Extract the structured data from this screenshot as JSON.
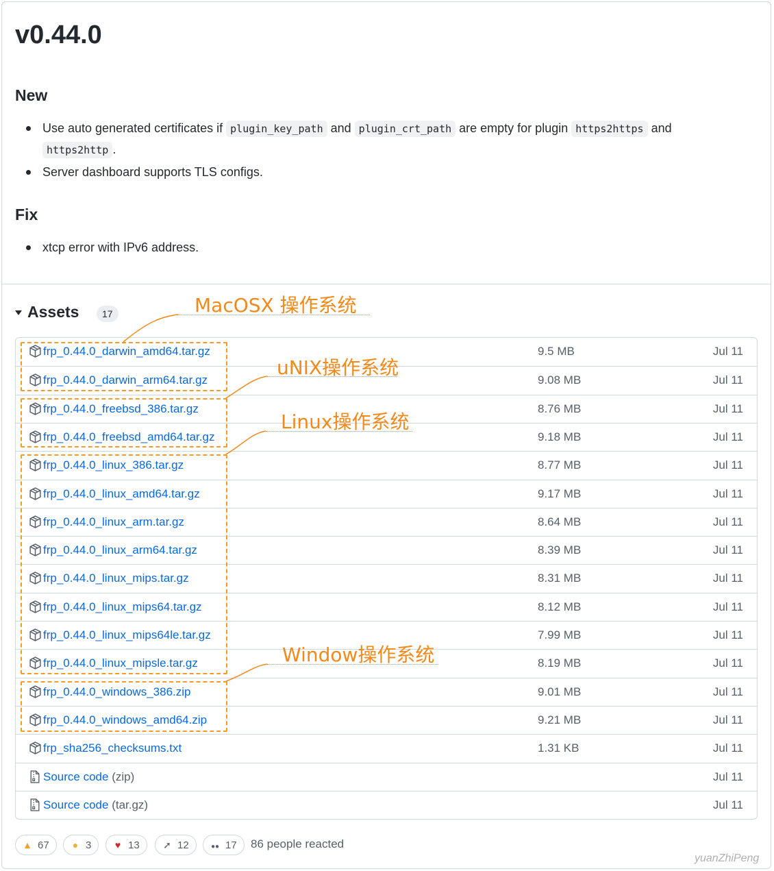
{
  "release": {
    "title": "v0.44.0",
    "new_heading": "New",
    "new_items": [
      {
        "parts": [
          "Use auto generated certificates if ",
          "plugin_key_path",
          " and ",
          "plugin_crt_path",
          " are empty for plugin ",
          "https2https",
          " and "
        ],
        "cont": [
          "https2http",
          "."
        ]
      },
      {
        "text": "Server dashboard supports TLS configs."
      }
    ],
    "fix_heading": "Fix",
    "fix_items": [
      "xtcp error with IPv6 address."
    ]
  },
  "assets": {
    "label": "Assets",
    "count": "17",
    "rows": [
      {
        "icon": "package-icon",
        "name": "frp_0.44.0_darwin_amd64.tar.gz",
        "size": "9.5 MB",
        "date": "Jul 11"
      },
      {
        "icon": "package-icon",
        "name": "frp_0.44.0_darwin_arm64.tar.gz",
        "size": "9.08 MB",
        "date": "Jul 11"
      },
      {
        "icon": "package-icon",
        "name": "frp_0.44.0_freebsd_386.tar.gz",
        "size": "8.76 MB",
        "date": "Jul 11"
      },
      {
        "icon": "package-icon",
        "name": "frp_0.44.0_freebsd_amd64.tar.gz",
        "size": "9.18 MB",
        "date": "Jul 11"
      },
      {
        "icon": "package-icon",
        "name": "frp_0.44.0_linux_386.tar.gz",
        "size": "8.77 MB",
        "date": "Jul 11"
      },
      {
        "icon": "package-icon",
        "name": "frp_0.44.0_linux_amd64.tar.gz",
        "size": "9.17 MB",
        "date": "Jul 11"
      },
      {
        "icon": "package-icon",
        "name": "frp_0.44.0_linux_arm.tar.gz",
        "size": "8.64 MB",
        "date": "Jul 11"
      },
      {
        "icon": "package-icon",
        "name": "frp_0.44.0_linux_arm64.tar.gz",
        "size": "8.39 MB",
        "date": "Jul 11"
      },
      {
        "icon": "package-icon",
        "name": "frp_0.44.0_linux_mips.tar.gz",
        "size": "8.31 MB",
        "date": "Jul 11"
      },
      {
        "icon": "package-icon",
        "name": "frp_0.44.0_linux_mips64.tar.gz",
        "size": "8.12 MB",
        "date": "Jul 11"
      },
      {
        "icon": "package-icon",
        "name": "frp_0.44.0_linux_mips64le.tar.gz",
        "size": "7.99 MB",
        "date": "Jul 11"
      },
      {
        "icon": "package-icon",
        "name": "frp_0.44.0_linux_mipsle.tar.gz",
        "size": "8.19 MB",
        "date": "Jul 11"
      },
      {
        "icon": "package-icon",
        "name": "frp_0.44.0_windows_386.zip",
        "size": "9.01 MB",
        "date": "Jul 11"
      },
      {
        "icon": "package-icon",
        "name": "frp_0.44.0_windows_amd64.zip",
        "size": "9.21 MB",
        "date": "Jul 11"
      },
      {
        "icon": "package-icon",
        "name": "frp_sha256_checksums.txt",
        "size": "1.31 KB",
        "date": "Jul 11"
      },
      {
        "icon": "file-zip-icon",
        "name": "Source code",
        "name_sub": "(zip)",
        "size": "",
        "date": "Jul 11"
      },
      {
        "icon": "file-zip-icon",
        "name": "Source code",
        "name_sub": "(tar.gz)",
        "size": "",
        "date": "Jul 11"
      }
    ]
  },
  "annotations": {
    "macos": "MacOSX 操作系统",
    "unix": "uNIX操作系统",
    "linux": "Linux操作系统",
    "windows": "Window操作系统",
    "color": "#f08a1c"
  },
  "reactions": {
    "items": [
      {
        "icon": "thumbs-up-icon",
        "count": "67"
      },
      {
        "icon": "laugh-icon",
        "count": "3"
      },
      {
        "icon": "heart-icon",
        "count": "13"
      },
      {
        "icon": "rocket-icon",
        "count": "12"
      },
      {
        "icon": "eyes-icon",
        "count": "17"
      }
    ],
    "summary": "86 people reacted"
  },
  "watermark": "yuanZhiPeng"
}
